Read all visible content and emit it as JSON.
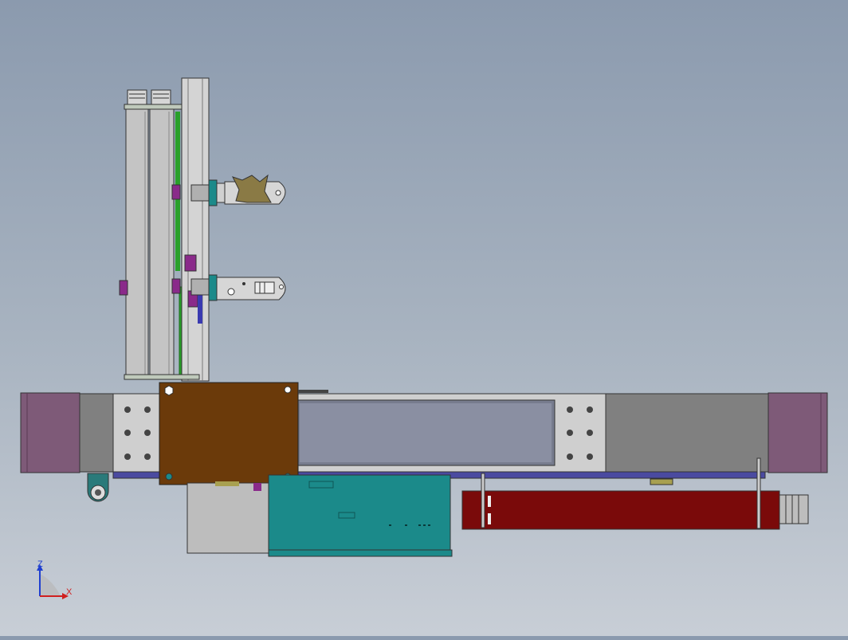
{
  "viewport": {
    "type": "cad-3d-viewport",
    "view": "front",
    "background": [
      "#8b9aae",
      "#c8ced6"
    ]
  },
  "triad": {
    "z_label": "Z",
    "x_label": "X",
    "colors": {
      "z": "#1f3fd0",
      "x": "#d01f1f",
      "y": "#2aa02a"
    }
  },
  "model": {
    "description_colors": {
      "frame": "#c9c9c9",
      "end_cap": "#7e5a78",
      "carriage_plate": "#6b3a0a",
      "motor_box": "#1b8a8a",
      "cylinder": "#7a0a0a",
      "pneumatic_rod": "#2aa02a",
      "bracket_purple": "#8a2a8a"
    }
  }
}
